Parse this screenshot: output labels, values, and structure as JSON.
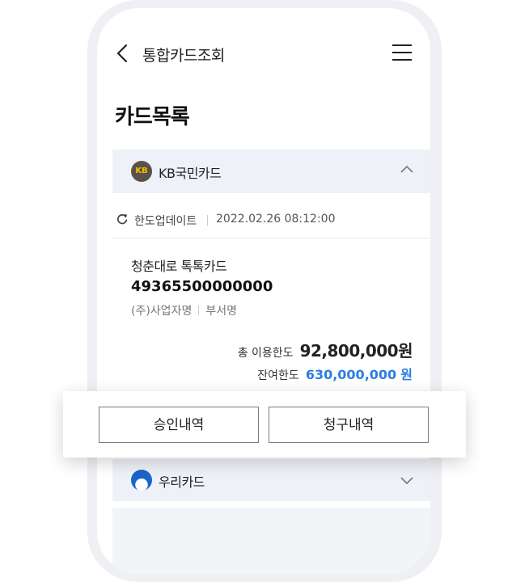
{
  "header": {
    "title": "통합카드조회"
  },
  "page": {
    "title": "카드목록"
  },
  "companies": [
    {
      "name": "KB국민카드",
      "logo_text": "KB"
    },
    {
      "name": "우리카드"
    }
  ],
  "limit_update": {
    "label": "한도업데이트",
    "timestamp": "2022.02.26  08:12:00"
  },
  "card": {
    "name": "청춘대로 톡톡카드",
    "number": "49365500000000",
    "business_name": "(주)사업자명",
    "department": "부서명",
    "total_limit_label": "총 이용한도",
    "total_limit_value": "92,800,000",
    "remaining_limit_label": "잔여한도",
    "remaining_limit_value": "630,000,000",
    "currency": "원"
  },
  "actions": {
    "approval_label": "승인내역",
    "billing_label": "청구내역"
  },
  "colors": {
    "accent_blue": "#2b7de0",
    "section_bg": "#eef1f7",
    "kb_logo_bg": "#5a524a",
    "kb_logo_fg": "#f2c200"
  }
}
